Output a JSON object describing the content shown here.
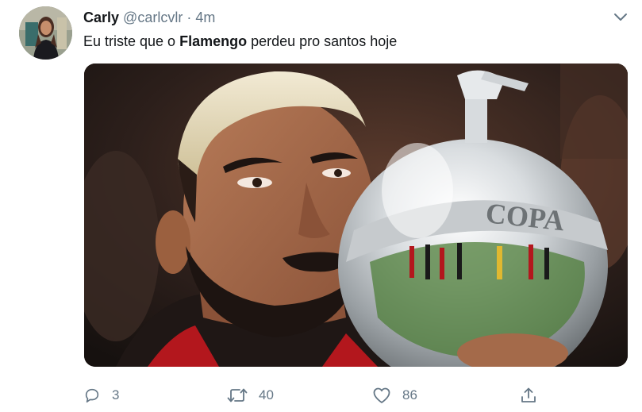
{
  "tweet": {
    "author_name": "Carly",
    "author_handle": "@carlcvlr",
    "separator": "·",
    "timestamp": "4m",
    "text_before": "Eu triste que o ",
    "text_bold": "Flamengo",
    "text_after": " perdeu pro santos hoje",
    "image_lettering": "COPA",
    "icons": {
      "more": "chevron-down-icon",
      "reply": "speech-bubble-icon",
      "retweet": "retweet-arrows-icon",
      "like": "heart-icon",
      "share": "share-upload-icon"
    },
    "actions": {
      "replies": "3",
      "retweets": "40",
      "likes": "86"
    },
    "colors": {
      "text": "#14171a",
      "secondary": "#657786",
      "background": "#ffffff"
    }
  }
}
